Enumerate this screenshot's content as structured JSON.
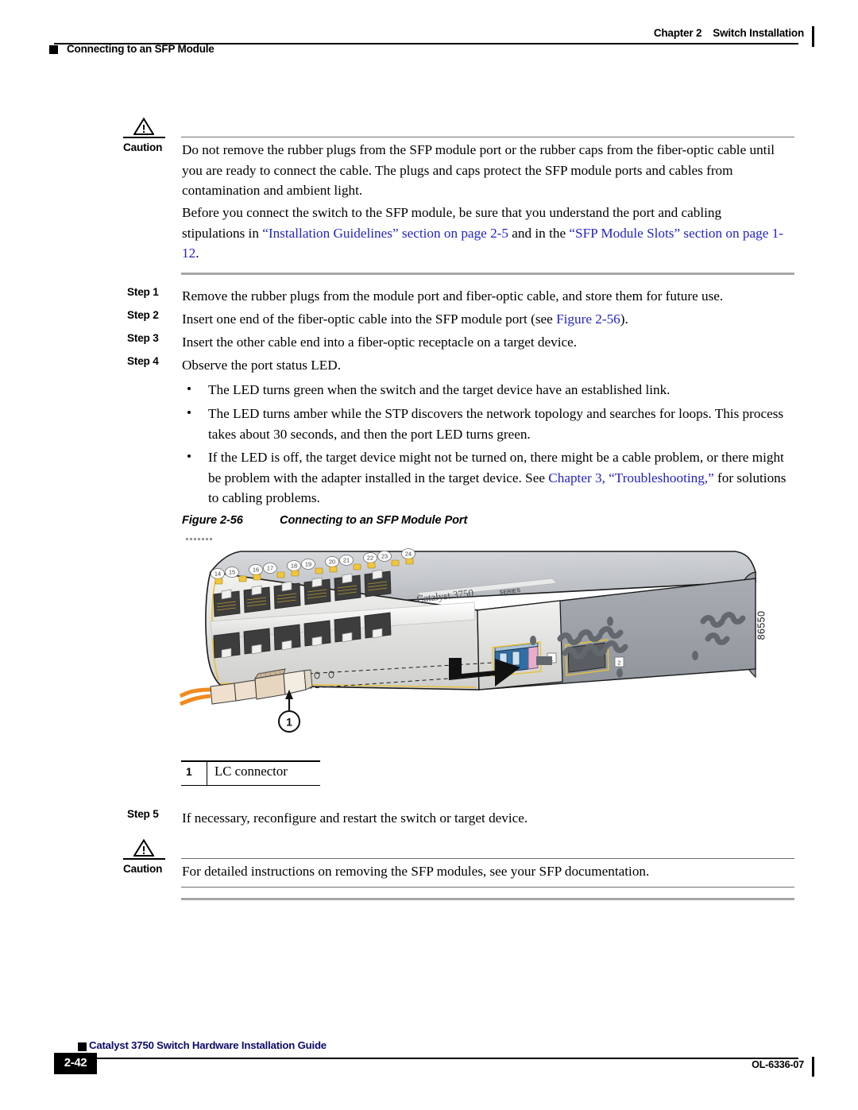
{
  "header": {
    "chapter_label": "Chapter 2",
    "chapter_title": "Switch Installation",
    "section_title": "Connecting to an SFP Module"
  },
  "caution_top": {
    "label": "Caution",
    "text": "Do not remove the rubber plugs from the SFP module port or the rubber caps from the fiber-optic cable until you are ready to connect the cable. The plugs and caps protect the SFP module ports and cables from contamination and ambient light."
  },
  "intro_paragraph": {
    "part1": "Before you connect the switch to the SFP module, be sure that you understand the port and cabling stipulations in ",
    "link1": "“Installation Guidelines” section on page 2-5",
    "part2": " and in the ",
    "link2": "“SFP Module Slots” section on page 1-12",
    "part3": "."
  },
  "steps": [
    {
      "label": "Step 1",
      "text": "Remove the rubber plugs from the module port and fiber-optic cable, and store them for future use."
    },
    {
      "label": "Step 2",
      "text_before": "Insert one end of the fiber-optic cable into the SFP module port (see ",
      "link": "Figure 2-56",
      "text_after": ")."
    },
    {
      "label": "Step 3",
      "text": "Insert the other cable end into a fiber-optic receptacle on a target device."
    },
    {
      "label": "Step 4",
      "text": "Observe the port status LED."
    },
    {
      "label": "Step 5",
      "text": "If necessary, reconfigure and restart the switch or target device."
    }
  ],
  "bullets": [
    {
      "text": "The LED turns green when the switch and the target device have an established link."
    },
    {
      "text": "The LED turns amber while the STP discovers the network topology and searches for loops. This process takes about 30 seconds, and then the port LED turns green."
    },
    {
      "text_before": "If the LED is off, the target device might not be turned on, there might be a cable problem, or there might be problem with the adapter installed in the target device. See ",
      "link": "Chapter 3, “Troubleshooting,”",
      "text_after": " for solutions to cabling problems."
    }
  ],
  "figure": {
    "number": "Figure 2-56",
    "title": "Connecting to an SFP Module Port",
    "art_id": "86550",
    "device_brand": "Catalyst 3750",
    "device_series": "SERIES",
    "port_numbers": [
      "14",
      "15",
      "16",
      "17",
      "18",
      "19",
      "20",
      "21",
      "22",
      "23",
      "24"
    ],
    "slot_labels": [
      "1",
      "2"
    ],
    "callout_marker": "1",
    "legend": [
      {
        "num": "1",
        "text": "LC connector"
      }
    ]
  },
  "caution_bottom": {
    "label": "Caution",
    "text": "For detailed instructions on removing the SFP modules, see your SFP documentation."
  },
  "footer": {
    "page_number": "2-42",
    "guide_title": "Catalyst 3750 Switch Hardware Installation Guide",
    "doc_id": "OL-6336-07"
  },
  "colors": {
    "link": "#2222cc",
    "rule_gray": "#a6a6a6",
    "accent_orange": "#f18a21",
    "sfp_blue": "#2f6fa8",
    "sfp_pink": "#e6aecb"
  }
}
